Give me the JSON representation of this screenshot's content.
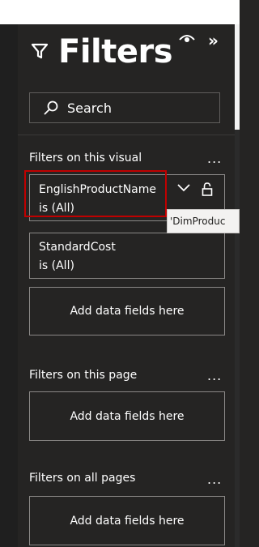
{
  "header": {
    "title": "Filters",
    "icons": {
      "filter": "filter-icon",
      "visibility": "eye-icon",
      "collapse": "double-chevron-right-icon"
    },
    "collapse_glyph": "»"
  },
  "search": {
    "label": "Search",
    "icon": "search-icon"
  },
  "sections": {
    "visual": {
      "title": "Filters on this visual",
      "more": "...",
      "cards": [
        {
          "field": "EnglishProductName",
          "condition": "is (All)"
        },
        {
          "field": "StandardCost",
          "condition": "is (All)"
        }
      ],
      "add_label": "Add data fields here"
    },
    "page": {
      "title": "Filters on this page",
      "more": "...",
      "add_label": "Add data fields here"
    },
    "all_pages": {
      "title": "Filters on all pages",
      "more": "...",
      "add_label": "Add data fields here"
    }
  },
  "tooltip": {
    "text": "'DimProduc"
  },
  "colors": {
    "panel_bg": "#252423",
    "card_border": "#8a8886",
    "highlight": "#c00000",
    "text": "#ffffff"
  }
}
